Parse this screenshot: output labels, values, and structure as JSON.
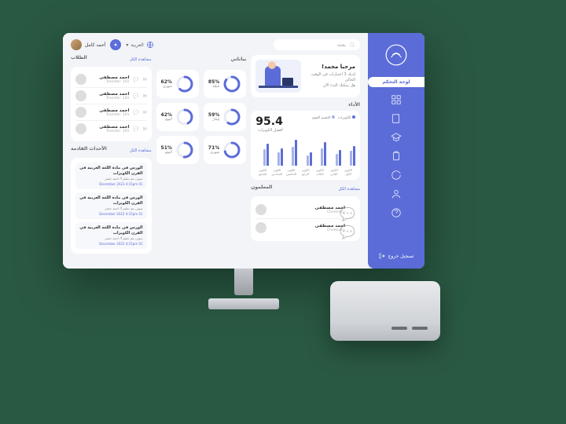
{
  "sidebar": {
    "active_label": "لوحة التحكم",
    "logout": "تسجيل خروج",
    "icons": [
      "dashboard",
      "courses",
      "students",
      "assignments",
      "calendar",
      "profile",
      "help"
    ]
  },
  "topbar": {
    "search_placeholder": "بحث",
    "language": "العربية",
    "user_name": "أحمد كامل"
  },
  "welcome": {
    "title": "مرحبا محمد!",
    "line1": "لديك 3 اختبارات في الوقت الحالي",
    "line2": "هل يمكنك البدء الآن"
  },
  "performance": {
    "section": "الأداء",
    "kpi_label": "أفضل الكويزات",
    "kpi_value": "95.4",
    "legend1": "الكويزات",
    "legend2": "التقييم القوم"
  },
  "chart_data": {
    "type": "bar",
    "categories": [
      "الكويز الأول",
      "الكويز الثاني",
      "الكويز الثالث",
      "الكويز الرابع",
      "الكويز الخامس",
      "الكويز السادس",
      "الكويز السابع"
    ],
    "series": [
      {
        "name": "الكويزات",
        "values": [
          70,
          56,
          84,
          48,
          92,
          62,
          78
        ]
      },
      {
        "name": "التقييم القوم",
        "values": [
          52,
          42,
          60,
          36,
          68,
          46,
          58
        ]
      }
    ],
    "ylim": [
      0,
      100
    ]
  },
  "stats": {
    "title": "بياناتي",
    "items": [
      {
        "pct": 85,
        "label": "خطة"
      },
      {
        "pct": 62,
        "label": "شهري"
      },
      {
        "pct": 59,
        "label": "إنجاز"
      },
      {
        "pct": 42,
        "label": "اليوم"
      },
      {
        "pct": 71,
        "label": "شهري"
      },
      {
        "pct": 51,
        "label": "اليوم"
      }
    ]
  },
  "teachers": {
    "section": "المعلمون",
    "link": "مشاهدة الكل",
    "list": [
      {
        "name": "احمد مصطفى",
        "sub": "Chemistry"
      },
      {
        "name": "احمد مصطفى",
        "sub": "Chemistry"
      }
    ]
  },
  "students": {
    "section": "الطلاب",
    "link": "مشاهدة الكل",
    "list": [
      {
        "name": "احمد مصطفى",
        "sub": "Transfer: 101"
      },
      {
        "name": "احمد مصطفى",
        "sub": "Transfer: 101"
      },
      {
        "name": "احمد مصطفى",
        "sub": "Transfer: 101"
      },
      {
        "name": "احمد مصطفى",
        "sub": "Transfer: 101"
      }
    ]
  },
  "events": {
    "section": "الأحداث القادمة",
    "link": "مشاهدة الكل",
    "list": [
      {
        "title": "الورس في مادة اللغة العربية في القرن الكويزات",
        "sub": "سوف يتم تعليم أ/ احمد جعفر",
        "date": "01 December 2023  4:15pm"
      },
      {
        "title": "الورس في مادة اللغة العربية في القرن الكويزات",
        "sub": "سوف يتم تعليم أ/ احمد جعفر",
        "date": "01 December 2023  4:15pm"
      },
      {
        "title": "الورس في مادة اللغة العربية في القرن الكويزات",
        "sub": "سوف يتم تعليم أ/ احمد جعفر",
        "date": "01 December 2023  4:15pm"
      }
    ]
  }
}
